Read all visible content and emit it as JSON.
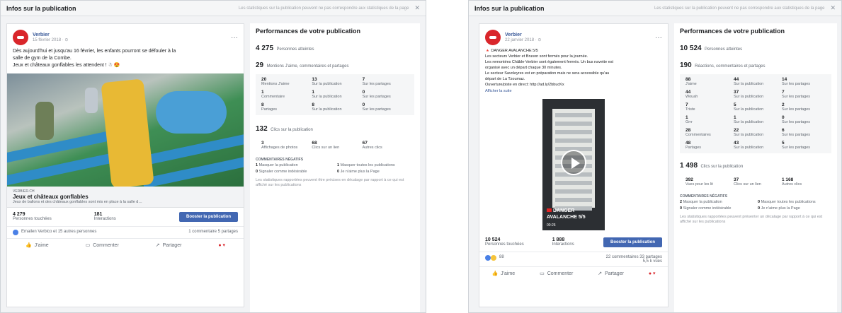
{
  "left": {
    "title": "Infos sur la publication",
    "hint": "Les statistiques sur la publication peuvent ne pas correspondre aux statistiques de la page",
    "post": {
      "page_name": "Verbier",
      "date": "15 février 2018 · ⊙",
      "text_line1": "Dès aujourd'hui et jusqu'au 16 février, les enfants pourront se défouler à la",
      "text_line2": "salle de gym de la Combe.",
      "text_line3": "Jeux et châteaux gonflables les attendent ! ☃ 😍",
      "link_domain": "VERBIER.CH",
      "link_title": "Jeux et châteaux gonflables",
      "link_desc": "Jeux de ballons et des châteaux gonflables sont mis en place à la salle d…",
      "people_reached_n": "4 279",
      "people_reached_l": "Personnes touchées",
      "interactions_n": "181",
      "interactions_l": "Interactions",
      "boost_label": "Booster la publication",
      "reactions_text": "Emailen Verbico et 15 autres personnes",
      "comments_shares": "1 commentaire  5 partages",
      "like": "J'aime",
      "comment": "Commenter",
      "share": "Partager"
    },
    "perf": {
      "title": "Performances de votre publication",
      "reach_n": "4 275",
      "reach_l": "Personnes atteintes",
      "engage_n": "29",
      "engage_l": "Mentions J'aime, commentaires et partages",
      "grid": [
        {
          "n": "20",
          "l": "Mentions J'aime"
        },
        {
          "n": "13",
          "l": "Sur la publication"
        },
        {
          "n": "7",
          "l": "Sur les partages"
        },
        {
          "n": "1",
          "l": "Commentaire"
        },
        {
          "n": "1",
          "l": "Sur la publication"
        },
        {
          "n": "0",
          "l": "Sur les partages"
        },
        {
          "n": "8",
          "l": "Partages"
        },
        {
          "n": "8",
          "l": "Sur la publication"
        },
        {
          "n": "0",
          "l": "Sur les partages"
        }
      ],
      "clicks_n": "132",
      "clicks_l": "Clics sur la publication",
      "clicks": [
        {
          "n": "3",
          "l": "Affichages de photos"
        },
        {
          "n": "68",
          "l": "Clics sur un lien"
        },
        {
          "n": "67",
          "l": "Autres clics"
        }
      ],
      "neg_title": "COMMENTAIRES NÉGATIFS",
      "neg": [
        {
          "n": "1",
          "l": "Masquer la publication"
        },
        {
          "n": "1",
          "l": "Masquer toutes les publications"
        },
        {
          "n": "0",
          "l": "Signaler comme indésirable"
        },
        {
          "n": "0",
          "l": "Je n'aime plus la Page"
        }
      ],
      "note": "Les statistiques rapportées peuvent être précises en décalage par rapport à ce qui est affiché sur les publications"
    }
  },
  "right": {
    "title": "Infos sur la publication",
    "hint": "Les statistiques sur la publication peuvent ne pas correspondre aux statistiques de la page",
    "post": {
      "page_name": "Verbier",
      "date": "22 janvier 2018 · ⊙",
      "lines": [
        "🔺 DANGER AVALANCHE 5/5",
        "Les secteurs Verbier et Bruson sont fermés pour la journée.",
        "Les remontées Châble-Verbier sont également fermés. Un bus navette est",
        "organisé avec un départ chaque 30 minutes.",
        "Le secteur Savoleyres est en préparation mais ne sera accessible qu'au",
        "départ de La Tzoumaz.",
        "Ouverture/piste en direct: http://ad.ly/2bbucKx"
      ],
      "see_translation": "Afficher la suite",
      "video_caption1": "DANGER",
      "video_caption2": "AVALANCHE 5/5",
      "video_dur": "00:26",
      "people_reached_n": "10 524",
      "people_reached_l": "Personnes touchées",
      "interactions_n": "1 888",
      "interactions_l": "Interactions",
      "boost_label": "Booster la publication",
      "reactions_text": "88",
      "comments_shares": "22 commentaires  33 partages",
      "views": "5,5 k vues",
      "like": "J'aime",
      "comment": "Commenter",
      "share": "Partager"
    },
    "perf": {
      "title": "Performances de votre publication",
      "reach_n": "10 524",
      "reach_l": "Personnes atteintes",
      "engage_n": "190",
      "engage_l": "Réactions, commentaires et partages",
      "grid": [
        {
          "n": "88",
          "l": "J'aime"
        },
        {
          "n": "44",
          "l": "Sur la publication"
        },
        {
          "n": "14",
          "l": "Sur les partages"
        },
        {
          "n": "44",
          "l": "Wouah"
        },
        {
          "n": "37",
          "l": "Sur la publication"
        },
        {
          "n": "7",
          "l": "Sur les partages"
        },
        {
          "n": "7",
          "l": "Triste"
        },
        {
          "n": "5",
          "l": "Sur la publication"
        },
        {
          "n": "2",
          "l": "Sur les partages"
        },
        {
          "n": "1",
          "l": "Grrr"
        },
        {
          "n": "1",
          "l": "Sur la publication"
        },
        {
          "n": "0",
          "l": "Sur les partages"
        },
        {
          "n": "28",
          "l": "Commentaires"
        },
        {
          "n": "22",
          "l": "Sur la publication"
        },
        {
          "n": "6",
          "l": "Sur les partages"
        },
        {
          "n": "48",
          "l": "Partages"
        },
        {
          "n": "43",
          "l": "Sur la publication"
        },
        {
          "n": "5",
          "l": "Sur les partages"
        }
      ],
      "clicks_n": "1 498",
      "clicks_l": "Clics sur la publication",
      "clicks": [
        {
          "n": "392",
          "l": "Vues pour les lit"
        },
        {
          "n": "37",
          "l": "Clics sur un lien"
        },
        {
          "n": "1 168",
          "l": "Autres clics"
        }
      ],
      "neg_title": "COMMENTAIRES NÉGATIFS",
      "neg": [
        {
          "n": "2",
          "l": "Masquer la publication"
        },
        {
          "n": "0",
          "l": "Masquer toutes les publications"
        },
        {
          "n": "0",
          "l": "Signaler comme indésirable"
        },
        {
          "n": "0",
          "l": "Je n'aime plus la Page"
        }
      ],
      "note": "Les statistiques rapportées peuvent présenter un décalage par rapport à ce qui est affiché sur les publications"
    }
  }
}
